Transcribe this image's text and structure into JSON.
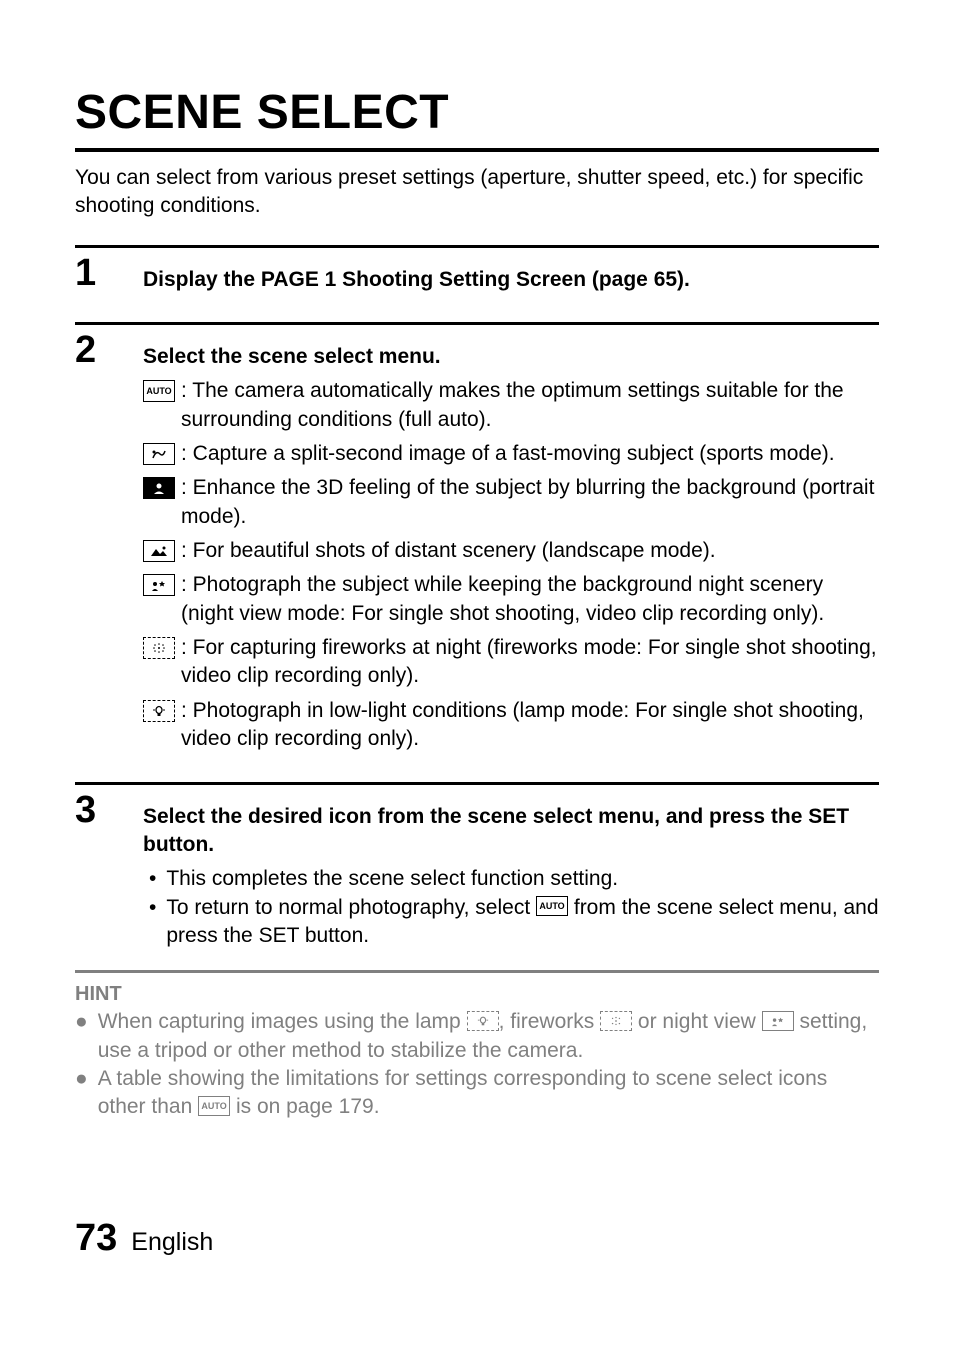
{
  "title": "SCENE SELECT",
  "intro": "You can select from various preset settings (aperture, shutter speed, etc.) for specific shooting conditions.",
  "steps": [
    {
      "num": "1",
      "heading": "Display the PAGE 1 Shooting Setting Screen (page 65)."
    },
    {
      "num": "2",
      "heading": "Select the scene select menu.",
      "modes": [
        {
          "icon": "AUTO",
          "desc": "The camera automatically makes the optimum settings suitable for the surrounding conditions (full auto)."
        },
        {
          "icon": "sports",
          "desc": "Capture a split-second image of a fast-moving subject (sports mode)."
        },
        {
          "icon": "portrait",
          "desc": "Enhance the 3D feeling of the subject by blurring the background (portrait mode)."
        },
        {
          "icon": "landscape",
          "desc": "For beautiful shots of distant scenery (landscape mode)."
        },
        {
          "icon": "nightview",
          "desc": "Photograph the subject while keeping the background night scenery (night view mode: For single shot shooting, video clip recording only)."
        },
        {
          "icon": "fireworks",
          "desc": "For capturing fireworks at night (fireworks mode: For single shot shooting, video clip recording only)."
        },
        {
          "icon": "lamp",
          "desc": "Photograph in low-light conditions (lamp mode: For single shot shooting, video clip recording only)."
        }
      ]
    },
    {
      "num": "3",
      "heading": "Select the desired icon from the scene select menu, and press the SET button.",
      "bullets": [
        {
          "text": "This completes the scene select function setting."
        },
        {
          "pre": "To return to normal photography, select ",
          "icon": "AUTO",
          "post": " from the scene select menu, and press the SET button."
        }
      ]
    }
  ],
  "hint": {
    "label": "HINT",
    "items": [
      {
        "parts": [
          {
            "t": "When capturing images using the lamp "
          },
          {
            "icon": "lamp"
          },
          {
            "t": ", fireworks "
          },
          {
            "icon": "fireworks"
          },
          {
            "t": " or night view "
          },
          {
            "icon": "nightview"
          },
          {
            "t": " setting, use a tripod or other method to stabilize the camera."
          }
        ]
      },
      {
        "parts": [
          {
            "t": "A table showing the limitations for settings corresponding to scene select icons other than "
          },
          {
            "icon": "AUTO"
          },
          {
            "t": " is on page 179."
          }
        ]
      }
    ]
  },
  "footer": {
    "page": "73",
    "lang": "English"
  }
}
